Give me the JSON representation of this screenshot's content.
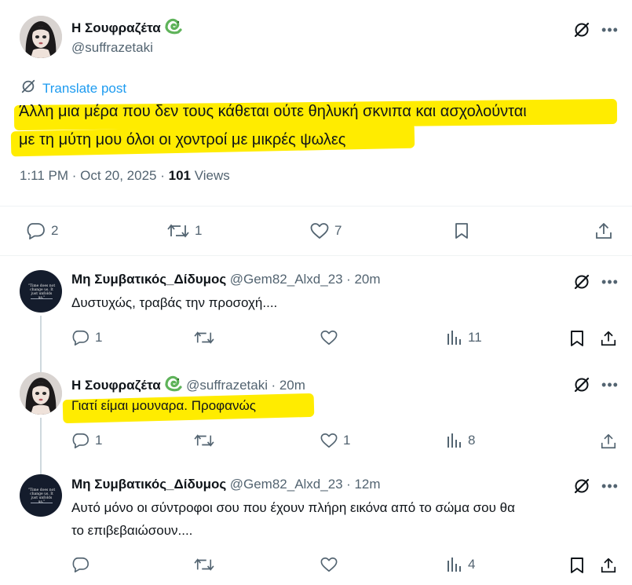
{
  "main_post": {
    "author_name": "Η Σουφραζέτα",
    "author_handle": "@suffrazetaki",
    "translate_label": "Translate post",
    "text_line1": "Άλλη μια μέρα που δεν τους κάθεται ούτε θηλυκή σκνιπα και ασχολούνται",
    "text_line2": "με τη μύτη μου όλοι οι χοντροί με μικρές ψωλες",
    "time": "1:11 PM · Oct 20, 2025 · ",
    "views_count": "101",
    "views_label": " Views",
    "replies": "2",
    "reposts": "1",
    "likes": "7"
  },
  "replies": [
    {
      "author_name": "Μη Συμβατικός_Δίδυμος",
      "author_handle": "@Gem82_Alxd_23",
      "time": "· 20m",
      "text": "Δυστυχώς, τραβάς την προσοχή....",
      "replies": "1",
      "reposts": "",
      "likes": "",
      "views": "11",
      "avatar_quote": "\"Time does not change us. It just unfolds us.\""
    },
    {
      "author_name": "Η Σουφραζέτα",
      "author_handle": "@suffrazetaki",
      "time": "· 20m",
      "text": "Γιατί είμαι μουναρα. Προφανώς",
      "replies": "1",
      "reposts": "",
      "likes": "1",
      "views": "8"
    },
    {
      "author_name": "Μη Συμβατικός_Δίδυμος",
      "author_handle": "@Gem82_Alxd_23",
      "time": "· 12m",
      "text_line1": "Αυτό μόνο οι σύντροφοι σου που έχουν πλήρη εικόνα από το σώμα σου θα",
      "text_line2": "το επιβεβαιώσουν....",
      "replies": "",
      "reposts": "",
      "likes": "",
      "views": "4",
      "avatar_quote": "\"Time does not change us. It just unfolds us.\""
    }
  ],
  "icons": {
    "badge": "green-snake-badge-icon",
    "grok": "grok-icon",
    "more": "more-icon",
    "reply": "reply-icon",
    "repost": "repost-icon",
    "like": "like-icon",
    "views": "views-icon",
    "bookmark": "bookmark-icon",
    "share": "share-icon"
  },
  "colors": {
    "highlight": "#ffec00",
    "link": "#1d9bf0",
    "muted": "#536471",
    "badge": "#5fb35a"
  }
}
